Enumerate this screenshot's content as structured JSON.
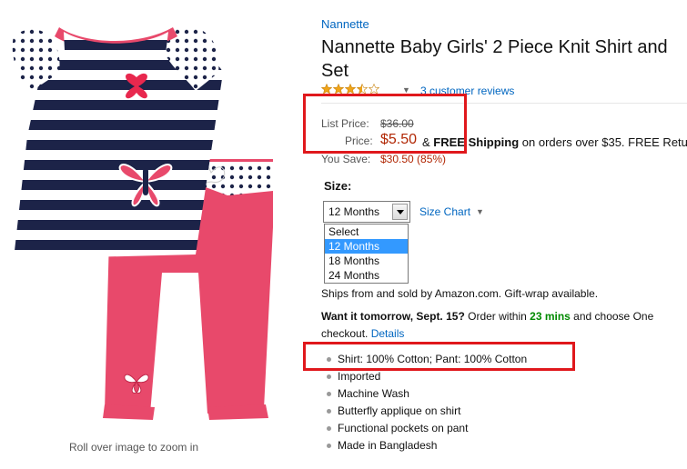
{
  "brand": "Nannette",
  "title_line1": "Nannette Baby Girls' 2 Piece Knit Shirt and",
  "title_line2": "Set",
  "rating": {
    "stars": 3.5,
    "reviews_link": "3 customer reviews"
  },
  "pricing": {
    "list_label": "List Price:",
    "list_value": "$36.00",
    "price_label": "Price:",
    "price_value": "$5.50",
    "shipping_pre": "& ",
    "shipping_bold": "FREE Shipping",
    "shipping_post": " on orders over $35. FREE Retu",
    "save_label": "You Save:",
    "save_value": "$30.50 (85%)"
  },
  "size": {
    "label": "Size:",
    "selected": "12 Months",
    "chart_link": "Size Chart",
    "options": [
      "Select",
      "12 Months",
      "18 Months",
      "24 Months"
    ]
  },
  "ships_text": "Ships from and sold by Amazon.com. Gift-wrap available.",
  "delivery": {
    "bold": "Want it tomorrow, Sept. 15?",
    "pre": " Order within ",
    "time": "23 mins",
    "post": " and choose One",
    "line2": "checkout. ",
    "details_link": "Details"
  },
  "bullets": [
    "Shirt: 100% Cotton; Pant: 100% Cotton",
    "Imported",
    "Machine Wash",
    "Butterfly applique on shirt",
    "Functional pockets on pant",
    "Made in Bangladesh"
  ],
  "zoom_hint": "Roll over image to zoom in",
  "colors": {
    "link": "#0066c0",
    "price": "#b12704",
    "highlight": "#e0181c",
    "star": "#f0a418"
  }
}
